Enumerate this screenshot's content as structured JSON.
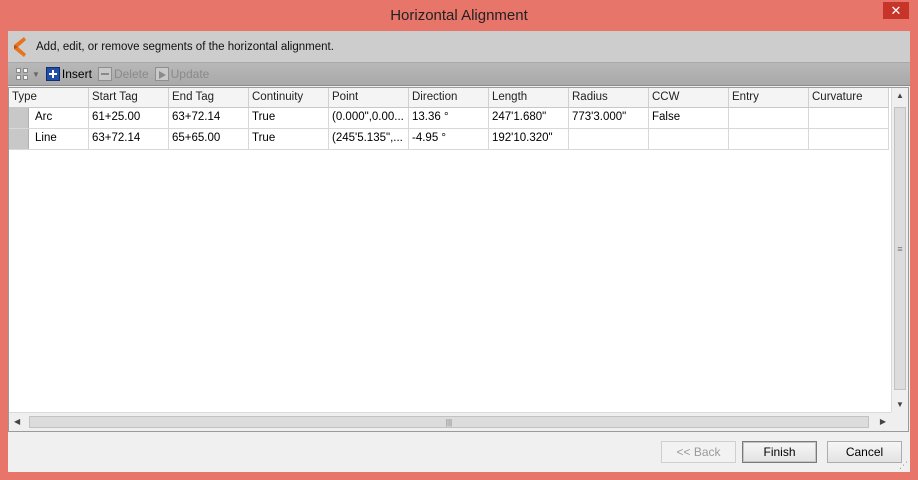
{
  "window": {
    "title": "Horizontal Alignment",
    "close_glyph": "✕"
  },
  "header": {
    "instruction": "Add, edit, or remove segments of the horizontal alignment."
  },
  "toolbar": {
    "insert_label": "Insert",
    "delete_label": "Delete",
    "update_label": "Update"
  },
  "table": {
    "columns": [
      "Type",
      "Start Tag",
      "End Tag",
      "Continuity",
      "Point",
      "Direction",
      "Length",
      "Radius",
      "CCW",
      "Entry",
      "Curvature"
    ],
    "rows": [
      [
        "Arc",
        "61+25.00",
        "63+72.14",
        "True",
        "(0.000\",0.00...",
        "13.36 °",
        "247'1.680\"",
        "773'3.000\"",
        "False",
        "",
        ""
      ],
      [
        "Line",
        "63+72.14",
        "65+65.00",
        "True",
        "(245'5.135\",...",
        "-4.95 °",
        "192'10.320\"",
        "",
        "",
        "",
        ""
      ]
    ]
  },
  "footer": {
    "back_label": "<< Back",
    "finish_label": "Finish",
    "cancel_label": "Cancel"
  },
  "colors": {
    "window_frame": "#e8756a",
    "close_button": "#c7352a",
    "logo": "#e8731c"
  }
}
